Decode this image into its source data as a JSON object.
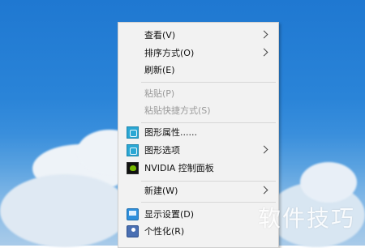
{
  "context_menu": {
    "items": [
      {
        "label": "查看(V)",
        "has_submenu": true,
        "enabled": true,
        "icon": "none"
      },
      {
        "label": "排序方式(O)",
        "has_submenu": true,
        "enabled": true,
        "icon": "none"
      },
      {
        "label": "刷新(E)",
        "has_submenu": false,
        "enabled": true,
        "icon": "none"
      },
      {
        "label": "粘贴(P)",
        "has_submenu": false,
        "enabled": false,
        "icon": "none"
      },
      {
        "label": "粘贴快捷方式(S)",
        "has_submenu": false,
        "enabled": false,
        "icon": "none"
      },
      {
        "label": "图形属性......",
        "has_submenu": false,
        "enabled": true,
        "icon": "intel-graphics-icon"
      },
      {
        "label": "图形选项",
        "has_submenu": true,
        "enabled": true,
        "icon": "intel-graphics-icon"
      },
      {
        "label": "NVIDIA 控制面板",
        "has_submenu": false,
        "enabled": true,
        "icon": "nvidia-icon"
      },
      {
        "label": "新建(W)",
        "has_submenu": true,
        "enabled": true,
        "icon": "none"
      },
      {
        "label": "显示设置(D)",
        "has_submenu": false,
        "enabled": true,
        "icon": "display-settings-icon"
      },
      {
        "label": "个性化(R)",
        "has_submenu": false,
        "enabled": true,
        "icon": "personalize-icon"
      }
    ]
  },
  "watermark": {
    "text": "软件技巧"
  },
  "colors": {
    "menu_bg": "#f2f2f2",
    "desktop_sky": "#1f78d1",
    "disabled_text": "#9a9a9a"
  }
}
